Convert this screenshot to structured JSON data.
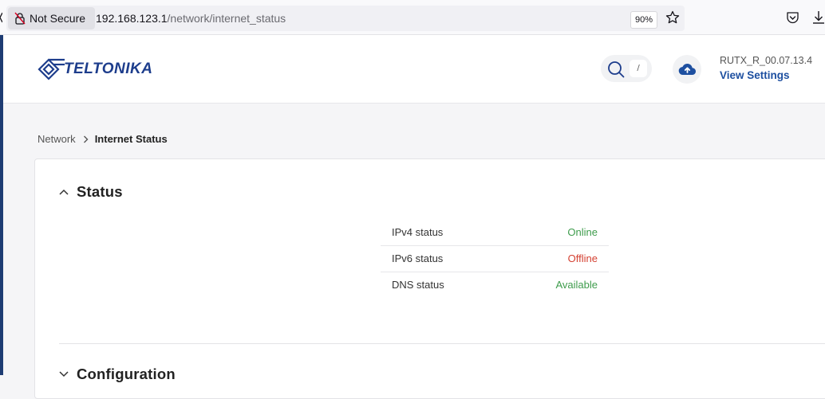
{
  "browser": {
    "security_label": "Not Secure",
    "url_host": "192.168.123.1",
    "url_path": "/network/internet_status",
    "zoom": "90%"
  },
  "header": {
    "logo_text": "TELTONIKA",
    "search_shortcut": "/",
    "firmware_version": "RUTX_R_00.07.13.4",
    "view_settings_label": "View Settings"
  },
  "breadcrumb": {
    "parent": "Network",
    "current": "Internet Status"
  },
  "status_section": {
    "title": "Status",
    "rows": [
      {
        "label": "IPv4 status",
        "value": "Online",
        "state": "good"
      },
      {
        "label": "IPv6 status",
        "value": "Offline",
        "state": "bad"
      },
      {
        "label": "DNS status",
        "value": "Available",
        "state": "good"
      }
    ]
  },
  "configuration_section": {
    "title": "Configuration"
  },
  "colors": {
    "accent": "#1e3c73",
    "brand": "#1d3d8c",
    "link": "#1d4fa0",
    "good": "#3e9c4c",
    "bad": "#d44132"
  },
  "icons": [
    "lock-slash-icon",
    "star-icon",
    "pocket-icon",
    "download-icon",
    "search-icon",
    "cloud-upload-icon",
    "chevron-right-icon",
    "chevron-up-icon"
  ]
}
